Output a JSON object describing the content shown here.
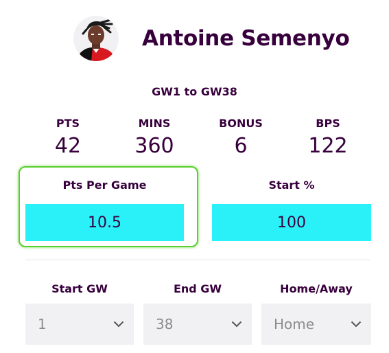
{
  "player": {
    "name": "Antoine Semenyo",
    "avatar_icon": "player-portrait-icon"
  },
  "range_label": "GW1 to GW38",
  "stats": [
    {
      "label": "PTS",
      "value": "42"
    },
    {
      "label": "MINS",
      "value": "360"
    },
    {
      "label": "BONUS",
      "value": "6"
    },
    {
      "label": "BPS",
      "value": "122"
    }
  ],
  "metrics": [
    {
      "label": "Pts Per Game",
      "value": "10.5"
    },
    {
      "label": "Start %",
      "value": "100"
    }
  ],
  "filters": [
    {
      "label": "Start GW",
      "value": "1"
    },
    {
      "label": "End GW",
      "value": "38"
    },
    {
      "label": "Home/Away",
      "value": "Home"
    }
  ],
  "colors": {
    "text": "#37003c",
    "metric_fill": "#2af0f8",
    "highlight_border": "#5acf2e",
    "select_bg": "#f1f1f3",
    "select_text": "#8b8b8b"
  }
}
